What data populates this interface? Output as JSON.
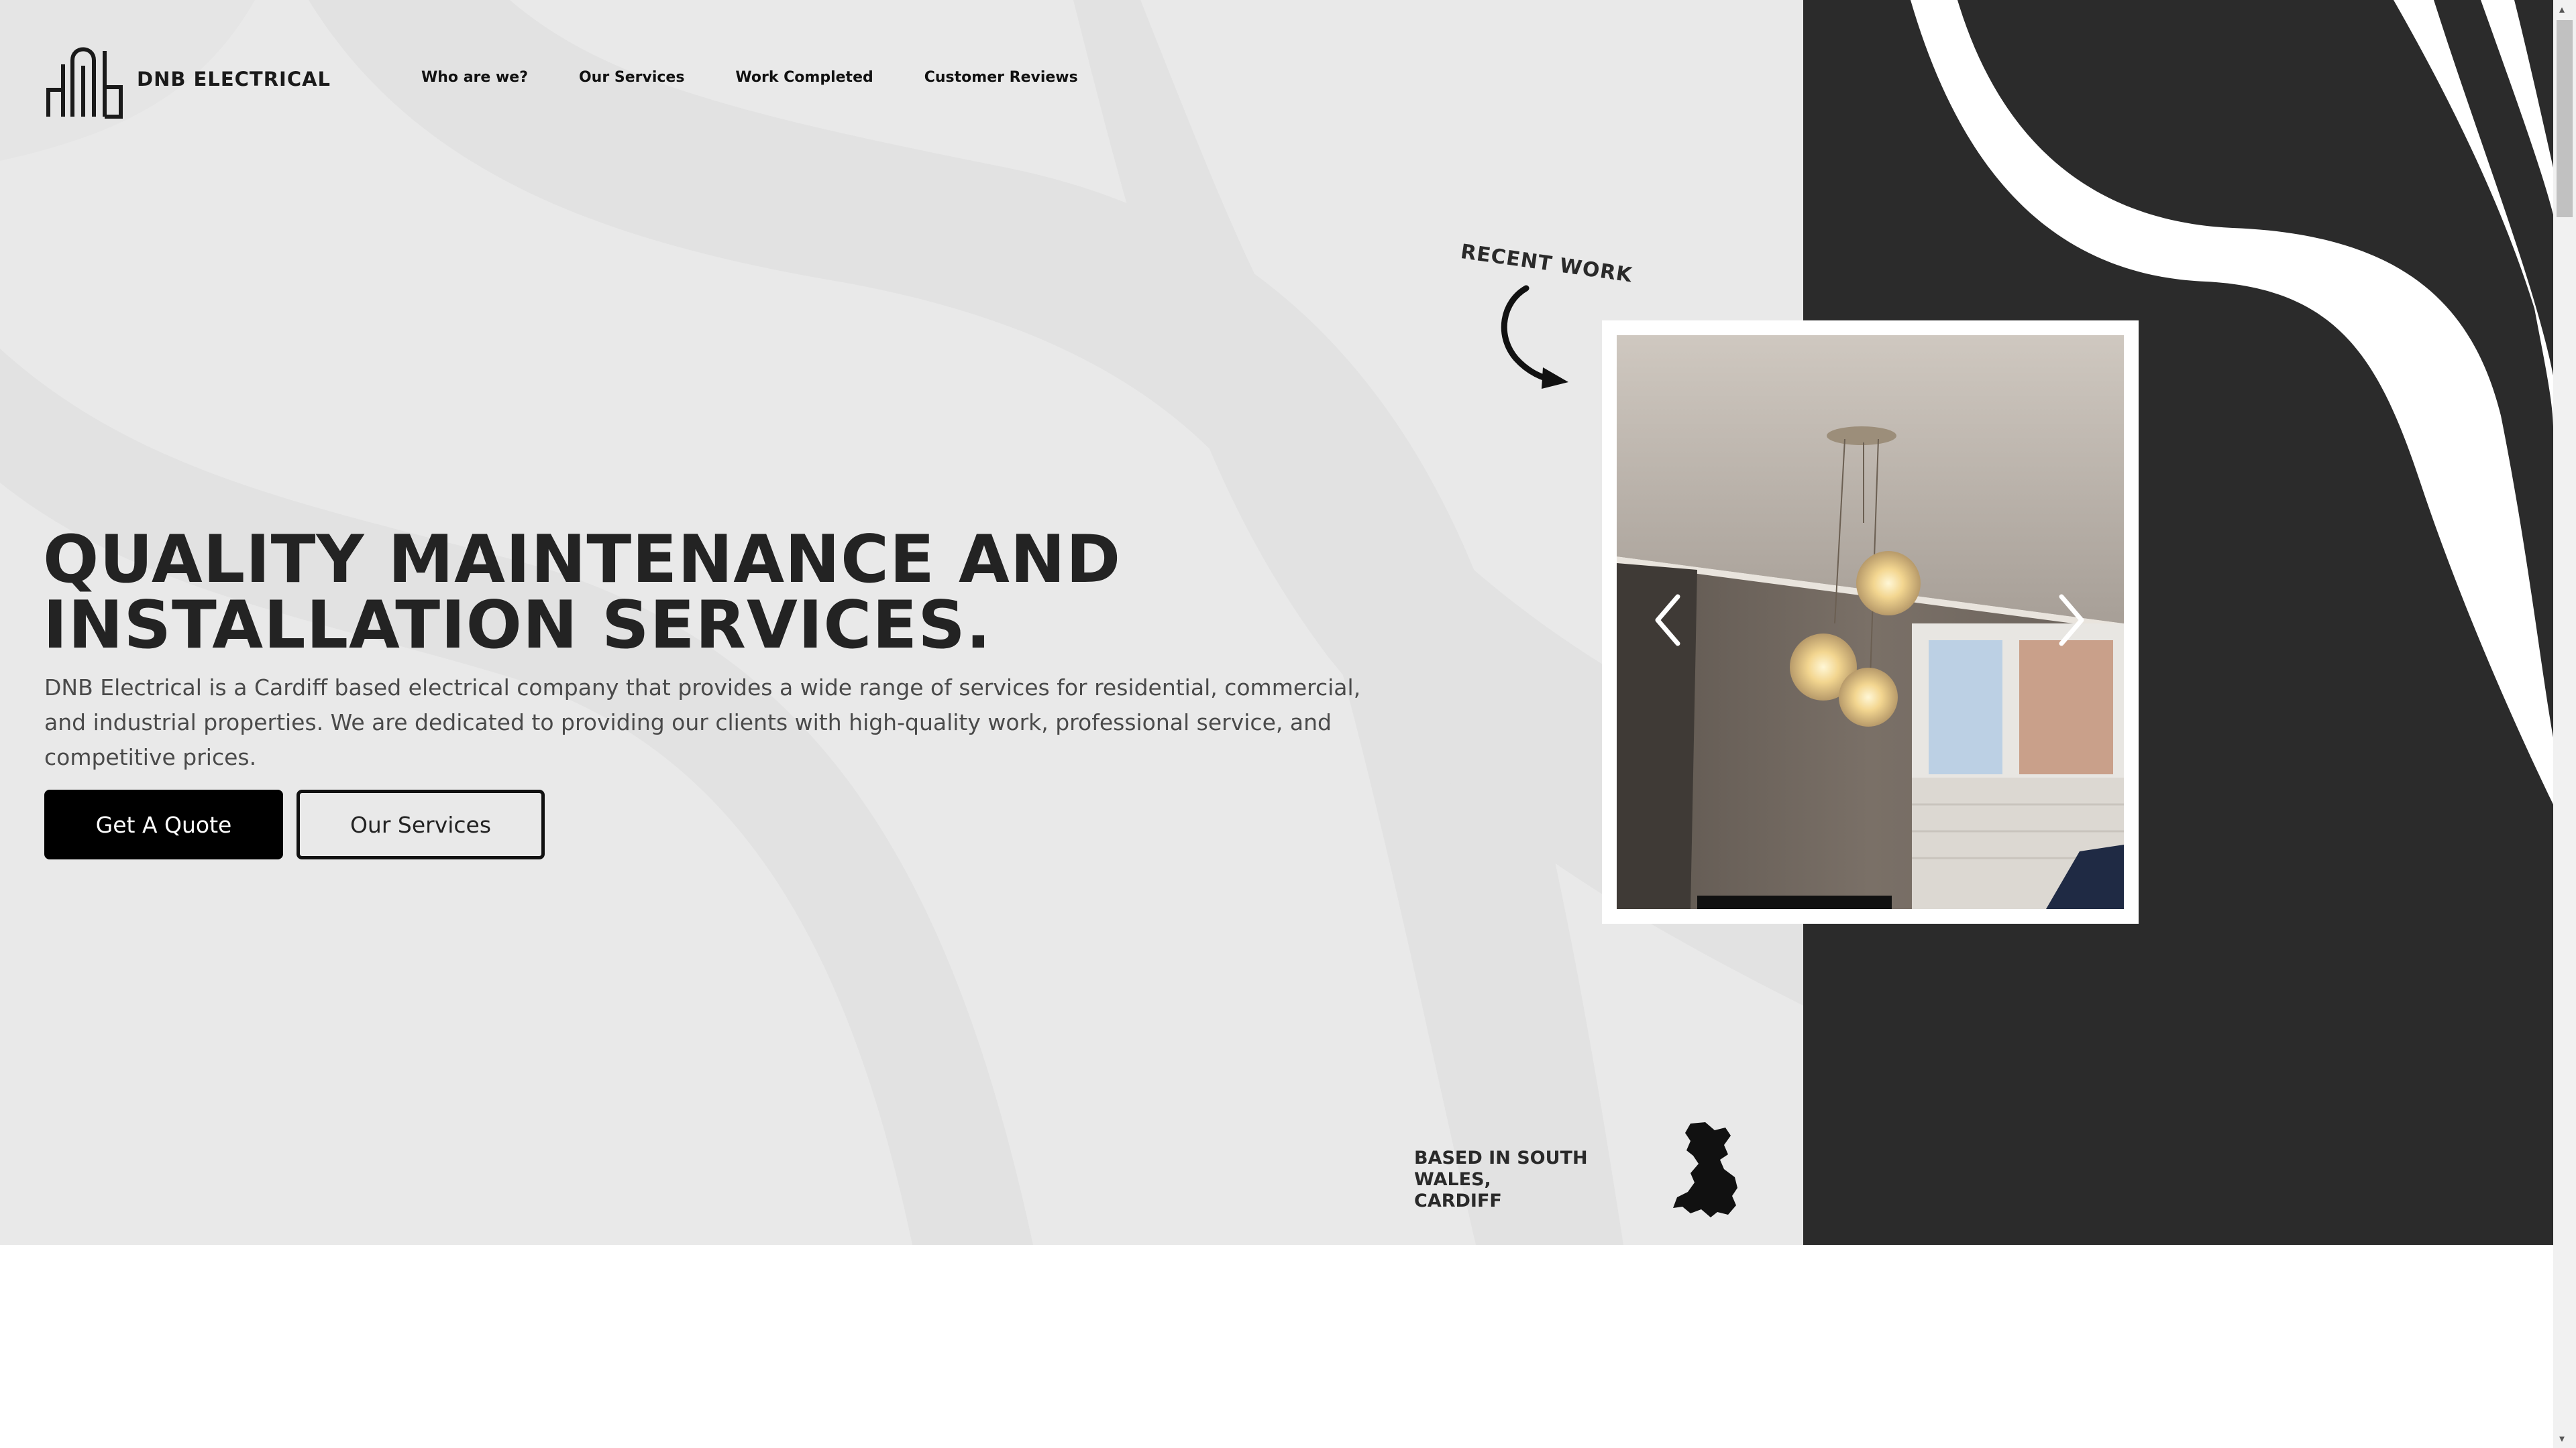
{
  "brand": {
    "name": "DNB ELECTRICAL",
    "logo_icon": "dnb-logo-icon"
  },
  "nav": {
    "items": [
      {
        "label": "Who are we?"
      },
      {
        "label": "Our Services"
      },
      {
        "label": "Work Completed"
      },
      {
        "label": "Customer Reviews"
      }
    ]
  },
  "hero": {
    "headline_line1": "QUALITY MAINTENANCE AND",
    "headline_line2": "INSTALLATION SERVICES.",
    "intro": "DNB Electrical is a Cardiff based electrical company that provides a wide range of services for residential, commercial, and industrial properties. We are dedicated to providing our clients with high-quality work, professional service, and competitive prices.",
    "primary_button": "Get A Quote",
    "secondary_button": "Our Services"
  },
  "recent_work": {
    "label": "RECENT WORK",
    "prev_icon": "chevron-left-icon",
    "next_icon": "chevron-right-icon"
  },
  "location": {
    "text_line1": "BASED IN SOUTH WALES,",
    "text_line2": "CARDIFF",
    "icon": "wales-map-icon"
  },
  "colors": {
    "hero_background": "#e9e9e9",
    "dark_panel": "#2b2b2b",
    "primary_button": "#000000",
    "text_dark": "#232323"
  }
}
